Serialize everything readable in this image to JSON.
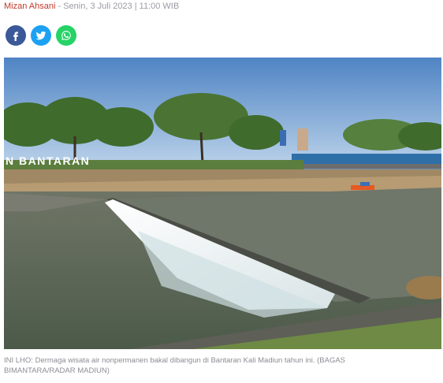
{
  "article": {
    "author": "Mizan Ahsani",
    "separator": " - ",
    "date": "Senin, 3 Juli 2023 | 11:00 WIB"
  },
  "share": [
    {
      "name": "facebook",
      "icon": "facebook-icon",
      "color": "#3b5998"
    },
    {
      "name": "twitter",
      "icon": "twitter-icon",
      "color": "#1da1f2"
    },
    {
      "name": "whatsapp",
      "icon": "whatsapp-icon",
      "color": "#25d366"
    }
  ],
  "photo": {
    "sign_text": "N BANTARAN"
  },
  "caption": "INI LHO: Dermaga wisata air nonpermanen bakal dibangun di Bantaran Kali Madiun tahun ini. (BAGAS BIMANTARA/RADAR MADIUN)"
}
